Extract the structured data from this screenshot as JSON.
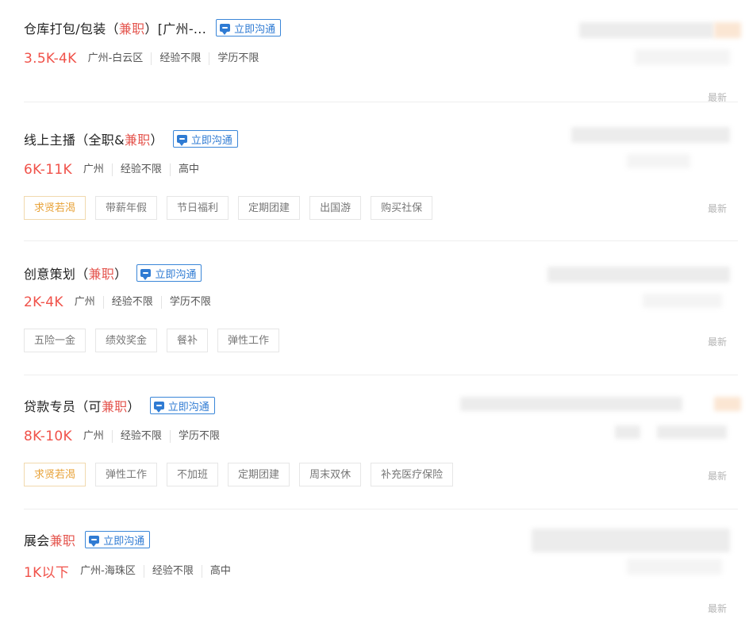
{
  "chat_label": "立即沟通",
  "jobs": [
    {
      "title_parts": [
        "仓库打包/包装（",
        "兼职",
        "）[广州-..."
      ],
      "salary": "3.5K-4K",
      "meta": [
        "广州-白云区",
        "经验不限",
        "学历不限"
      ],
      "tags": [],
      "update": "最新"
    },
    {
      "title_parts": [
        "线上主播（全职&",
        "兼职",
        "）"
      ],
      "salary": "6K-11K",
      "meta": [
        "广州",
        "经验不限",
        "高中"
      ],
      "tags": [
        {
          "label": "求贤若渴",
          "highlight": true
        },
        {
          "label": "带薪年假",
          "highlight": false
        },
        {
          "label": "节日福利",
          "highlight": false
        },
        {
          "label": "定期团建",
          "highlight": false
        },
        {
          "label": "出国游",
          "highlight": false
        },
        {
          "label": "购买社保",
          "highlight": false
        }
      ],
      "update": "最新"
    },
    {
      "title_parts": [
        "创意策划（",
        "兼职",
        "）"
      ],
      "salary": "2K-4K",
      "meta": [
        "广州",
        "经验不限",
        "学历不限"
      ],
      "tags": [
        {
          "label": "五险一金",
          "highlight": false
        },
        {
          "label": "绩效奖金",
          "highlight": false
        },
        {
          "label": "餐补",
          "highlight": false
        },
        {
          "label": "弹性工作",
          "highlight": false
        }
      ],
      "update": "最新"
    },
    {
      "title_parts": [
        "贷款专员（可",
        "兼职",
        "）"
      ],
      "salary": "8K-10K",
      "meta": [
        "广州",
        "经验不限",
        "学历不限"
      ],
      "tags": [
        {
          "label": "求贤若渴",
          "highlight": true
        },
        {
          "label": "弹性工作",
          "highlight": false
        },
        {
          "label": "不加班",
          "highlight": false
        },
        {
          "label": "定期团建",
          "highlight": false
        },
        {
          "label": "周末双休",
          "highlight": false
        },
        {
          "label": "补充医疗保险",
          "highlight": false
        }
      ],
      "update": "最新"
    },
    {
      "title_parts": [
        "展会",
        "兼职",
        ""
      ],
      "salary": "1K以下",
      "meta": [
        "广州-海珠区",
        "经验不限",
        "高中"
      ],
      "tags": [],
      "update": "最新"
    }
  ],
  "colors": {
    "salary": "#f0524a",
    "highlight_text": "#e4544d",
    "chat_button": "#2f7bd3",
    "highlight_tag": "#e8a33a"
  }
}
